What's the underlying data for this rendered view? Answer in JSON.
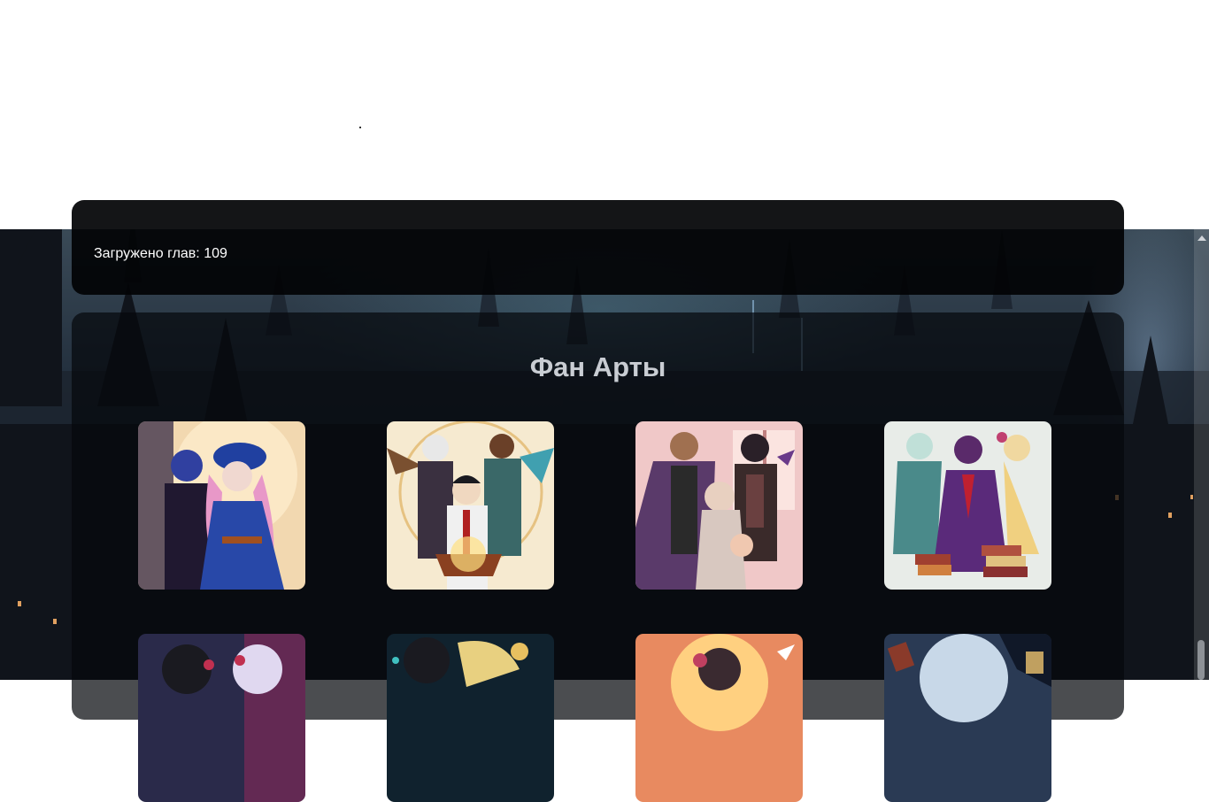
{
  "info": {
    "chapters_text": "Загружено глав: 109"
  },
  "fanarts": {
    "title": "Фан Арты",
    "items": [
      {
        "subject": "mage-girl-blue-robe",
        "c1": "#e8c9a0",
        "c2": "#2a4aa0",
        "c3": "#e89bd0"
      },
      {
        "subject": "trio-with-book",
        "c1": "#f4e6c0",
        "c2": "#3a6070",
        "c3": "#d8a040"
      },
      {
        "subject": "family-portrait",
        "c1": "#e6b8c8",
        "c2": "#3a2a2a",
        "c3": "#9a6ab0"
      },
      {
        "subject": "four-friends-books",
        "c1": "#d8e8e0",
        "c2": "#6a3a8a",
        "c3": "#c04050"
      },
      {
        "subject": "two-characters-night",
        "c1": "#2a2a4a",
        "c2": "#c03050",
        "c3": "#e8e0f0"
      },
      {
        "subject": "blond-and-dark-boy",
        "c1": "#1a2a3a",
        "c2": "#e8d080",
        "c3": "#40a0a0"
      },
      {
        "subject": "girl-with-rose-sunset",
        "c1": "#f0a060",
        "c2": "#c04060",
        "c3": "#ffd0a0"
      },
      {
        "subject": "moonlit-scene",
        "c1": "#3a5070",
        "c2": "#c0d0e0",
        "c3": "#1a2030"
      }
    ]
  },
  "colors": {
    "panel": "#020305",
    "title": "#c9cdd3"
  }
}
